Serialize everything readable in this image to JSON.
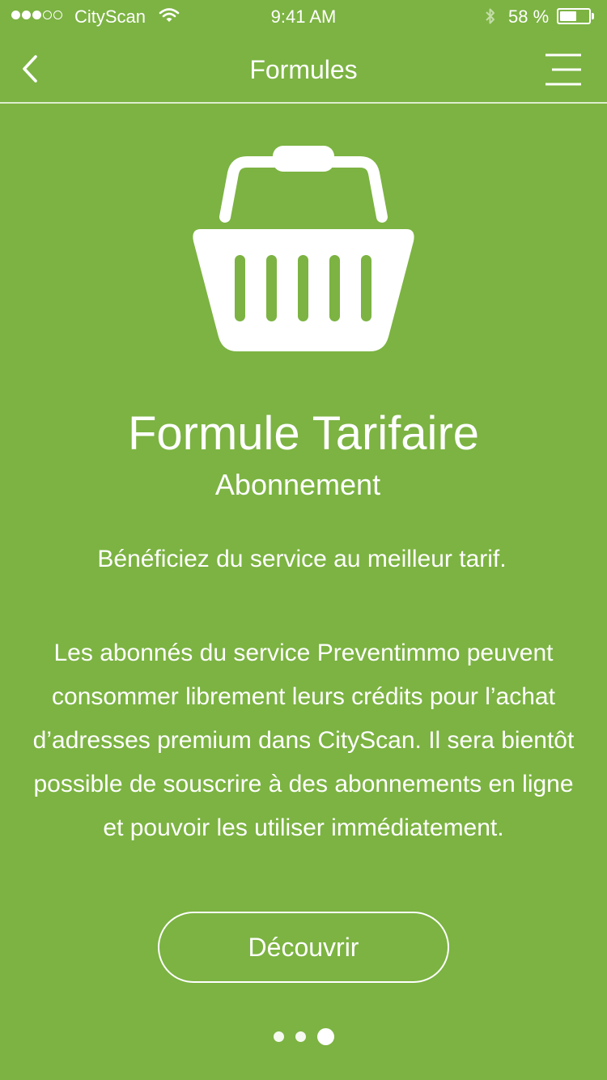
{
  "status_bar": {
    "carrier": "CityScan",
    "time": "9:41 AM",
    "battery_percent_label": "58 %",
    "battery_level": 0.58,
    "signal_bars_filled": 3,
    "signal_bars_total": 5,
    "icons": [
      "signal-dots",
      "wifi-icon",
      "bluetooth-icon",
      "battery-icon"
    ]
  },
  "nav": {
    "title": "Formules",
    "back_icon": "chevron-left-icon",
    "menu_icon": "menu-icon"
  },
  "hero": {
    "icon": "shopping-basket-icon",
    "title": "Formule Tarifaire",
    "subtitle": "Abonnement",
    "tagline": "Bénéficiez du service au meilleur tarif.",
    "description": "Les abonnés du service Preventimmo peuvent consommer librement leurs crédits pour l’achat d’adresses premium dans CityScan. Il sera bientôt possible de souscrire à des abonnements en ligne et pouvoir les utiliser immédiatement."
  },
  "cta": {
    "label": "Découvrir"
  },
  "pager": {
    "total_pages": 3,
    "current_page": 3
  },
  "colors": {
    "background": "#7cb342",
    "foreground": "#ffffff"
  }
}
